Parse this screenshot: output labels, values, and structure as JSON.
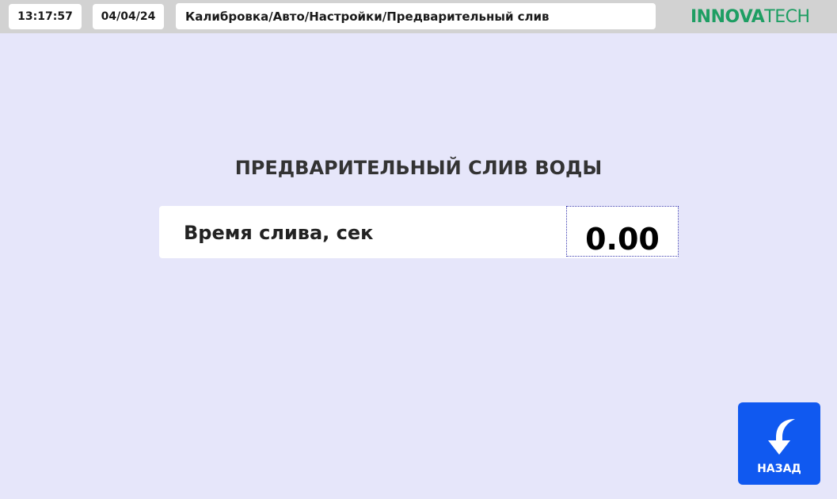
{
  "header": {
    "time": "13:17:57",
    "date": "04/04/24",
    "breadcrumb": "Калибровка/Авто/Настройки/Предварительный слив",
    "logo": {
      "pre": "INN",
      "leaf": "O",
      "mid": "VA",
      "post": "TECH"
    }
  },
  "main": {
    "title": "ПРЕДВАРИТЕЛЬНЫЙ СЛИВ ВОДЫ",
    "parameter": {
      "label": "Время слива, сек",
      "value": "0.00"
    }
  },
  "back_button": {
    "label": "НАЗАД",
    "icon": "curved-down-arrow-icon"
  },
  "colors": {
    "background": "#e6e6fa",
    "topbar": "#d2d2d2",
    "accent_button": "#1059f0",
    "logo_green": "#1e9e63"
  }
}
